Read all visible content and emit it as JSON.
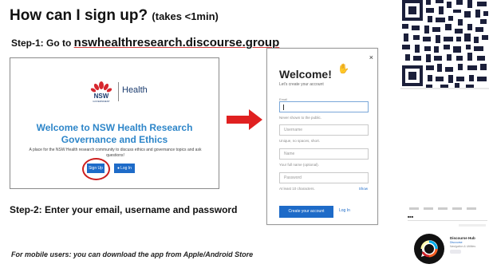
{
  "heading": {
    "title": "How can I sign up?",
    "subtitle": "(takes <1min)"
  },
  "step1": {
    "label": "Step-1: Go to",
    "url": "nswhealthresearch.discourse.group"
  },
  "landing": {
    "logo_text": "NSW",
    "logo_subtext": "GOVERNMENT",
    "health_label": "Health",
    "welcome_line1": "Welcome to NSW Health Research",
    "welcome_line2": "Governance and Ethics",
    "description": "A place for the NSW Health research community to discuss ethics and governance topics and ask questions!",
    "signup_button": "Sign Up",
    "login_button": "Log In",
    "highlight_color": "#cc1e1e"
  },
  "signup_modal": {
    "close": "×",
    "title": "Welcome!",
    "subtitle": "Let's create your account",
    "email_label": "Email",
    "email_help": "Never shown to the public.",
    "username_placeholder": "Username",
    "username_help": "Unique, no spaces, short.",
    "name_placeholder": "Name",
    "name_help": "Your full name (optional).",
    "password_placeholder": "Password",
    "password_help": "At least 10 characters.",
    "show_link": "Show",
    "create_button": "Create your account",
    "login_link": "Log In"
  },
  "step2": {
    "label": "Step-2: Enter your email, username and password"
  },
  "mobile_note": "For mobile users: you can download the app from Apple/Android Store",
  "app_store": {
    "app_name": "Discourse Hub",
    "developer": "Discourse",
    "category": "Navigation & Utilities",
    "rating_text": "Free"
  },
  "colors": {
    "accent_blue": "#1e6bc8",
    "heading_blue": "#2e86c9",
    "arrow_red": "#e02020"
  }
}
